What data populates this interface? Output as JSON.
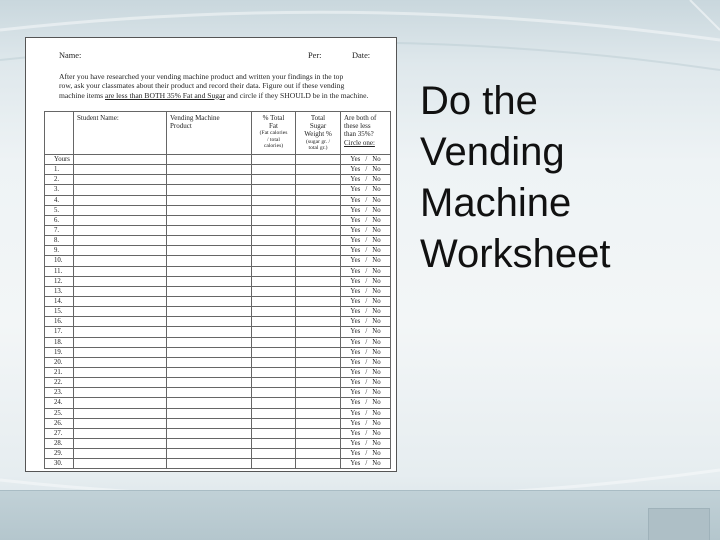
{
  "slide": {
    "title_lines": [
      "Do the",
      "Vending",
      "Machine",
      "Worksheet"
    ]
  },
  "worksheet": {
    "header": {
      "name_label": "Name:",
      "period_label": "Per:",
      "date_label": "Date:"
    },
    "intro": {
      "line1": "After you have researched your vending machine product and written your findings in the top",
      "line2": "row, ask your classmates about their product and record their data. Figure out if these vending",
      "line3_before": "machine items ",
      "line3_underlined": "are less than BOTH 35% Fat and Sugar",
      "line3_after": " and circle if they SHOULD be in the machine."
    },
    "columns": {
      "student_name": "Student Name:",
      "product_line1": "Vending Machine",
      "product_line2": "Product",
      "fat_line1": "% Total",
      "fat_line2": "Fat",
      "fat_note1": "(Fat calories",
      "fat_note2": "/ total",
      "fat_note3": "calories)",
      "sugar_line1": "Total",
      "sugar_line2": "Sugar",
      "sugar_line3": "Weight %",
      "sugar_note1": "(sugar gr. /",
      "sugar_note2": "total gr.)",
      "both_line1": "Are both of",
      "both_line2": "these less",
      "both_line3": "than 35%?",
      "both_line4": "Circle one:"
    },
    "yes_label": "Yes",
    "separator": "/",
    "no_label": "No",
    "rows": [
      "Yours",
      "1.",
      "2.",
      "3.",
      "4.",
      "5.",
      "6.",
      "7.",
      "8.",
      "9.",
      "10.",
      "11.",
      "12.",
      "13.",
      "14.",
      "15.",
      "16.",
      "17.",
      "18.",
      "19.",
      "20.",
      "21.",
      "22.",
      "23.",
      "24.",
      "25.",
      "26.",
      "27.",
      "28.",
      "29.",
      "30."
    ]
  }
}
